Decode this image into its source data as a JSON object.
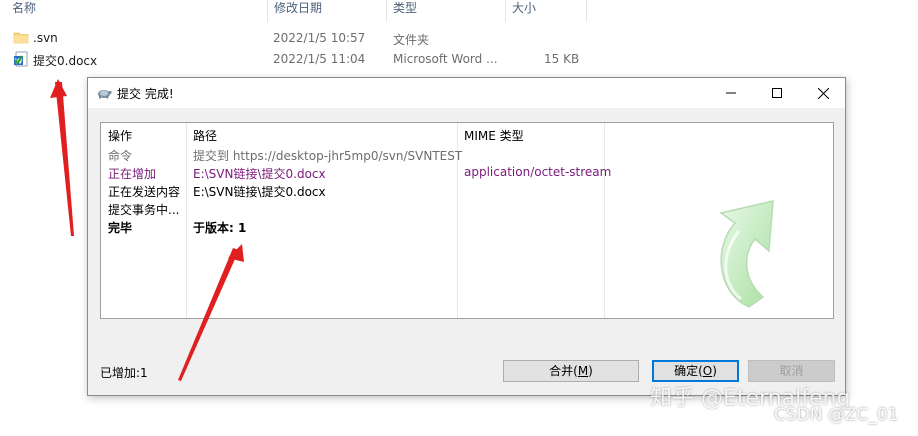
{
  "explorer": {
    "columns": {
      "name": "名称",
      "date": "修改日期",
      "type": "类型",
      "size": "大小"
    },
    "files": [
      {
        "name": ".svn",
        "date": "2022/1/5 10:57",
        "type": "文件夹",
        "size": "",
        "icon": "folder-icon"
      },
      {
        "name": "提交0.docx",
        "date": "2022/1/5 11:04",
        "type": "Microsoft Word ...",
        "size": "15 KB",
        "icon": "word-document-svn-icon"
      }
    ]
  },
  "dialog": {
    "title": "提交 完成!",
    "columns": {
      "action": "操作",
      "path": "路径",
      "mime": "MIME 类型"
    },
    "rows": [
      {
        "action": "命令",
        "path": "提交到 https://desktop-jhr5mp0/svn/SVNTEST",
        "mime": "",
        "style": "gray"
      },
      {
        "action": "正在增加",
        "path": "E:\\SVN链接\\提交0.docx",
        "mime": "application/octet-stream",
        "style": "purple"
      },
      {
        "action": "正在发送内容",
        "path": "E:\\SVN链接\\提交0.docx",
        "mime": "",
        "style": "black"
      },
      {
        "action": "提交事务中...",
        "path": "",
        "mime": "",
        "style": "black"
      },
      {
        "action": "完毕",
        "path": "于版本: 1",
        "mime": "",
        "style": "bold"
      }
    ],
    "status": "已增加:1",
    "buttons": {
      "merge": {
        "label": "合并(",
        "key": "M",
        "tail": ")"
      },
      "ok": {
        "label": "确定(",
        "key": "O",
        "tail": ")"
      },
      "cancel": "取消"
    }
  },
  "watermarks": {
    "zhihu": "知乎 @Eternalfeng",
    "csdn": "CSDN @ZC_01"
  },
  "colors": {
    "accent": "#0078d7",
    "added": "#7a1a7a",
    "annotation_arrow": "#e02020",
    "success_arrow": "#8fd88f"
  }
}
